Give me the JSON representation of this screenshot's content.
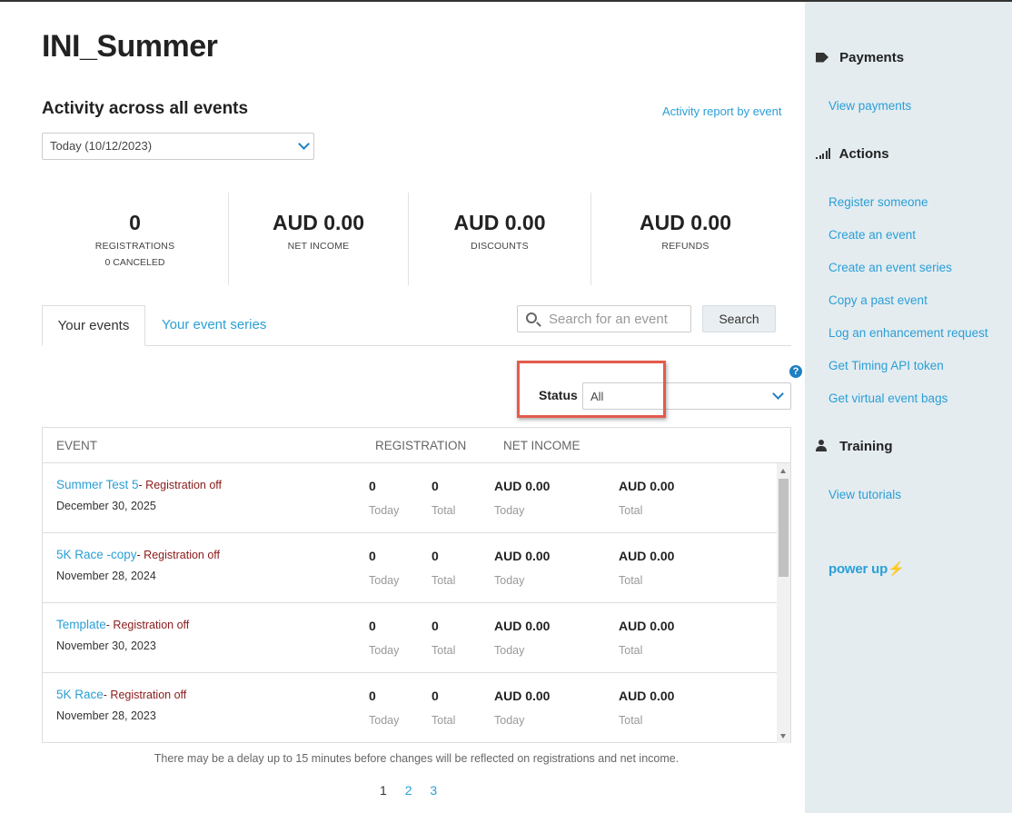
{
  "page": {
    "title": "INI_Summer"
  },
  "activity": {
    "title": "Activity across all events",
    "report_link": "Activity report by event",
    "date_range": "Today (10/12/2023)"
  },
  "stats": [
    {
      "value": "0",
      "label": "REGISTRATIONS",
      "sub": "0 CANCELED"
    },
    {
      "value": "AUD 0.00",
      "label": "NET INCOME"
    },
    {
      "value": "AUD 0.00",
      "label": "DISCOUNTS"
    },
    {
      "value": "AUD 0.00",
      "label": "REFUNDS"
    }
  ],
  "tabs": {
    "active": "Your events",
    "other": "Your event series"
  },
  "search": {
    "placeholder": "Search for an event",
    "button": "Search"
  },
  "status": {
    "label": "Status",
    "value": "All",
    "help": "?"
  },
  "table": {
    "headers": {
      "event": "EVENT",
      "registration": "REGISTRATION",
      "net_income": "NET INCOME"
    },
    "captions": {
      "today": "Today",
      "total": "Total"
    },
    "rows": [
      {
        "name": "Summer Test 5",
        "status": "- Registration off",
        "date": "December 30, 2025",
        "reg_today": "0",
        "reg_total": "0",
        "inc_today": "AUD 0.00",
        "inc_total": "AUD 0.00"
      },
      {
        "name": "5K Race -copy",
        "status": "- Registration off",
        "date": "November 28, 2024",
        "reg_today": "0",
        "reg_total": "0",
        "inc_today": "AUD 0.00",
        "inc_total": "AUD 0.00"
      },
      {
        "name": "Template",
        "status": "- Registration off",
        "date": "November 30, 2023",
        "reg_today": "0",
        "reg_total": "0",
        "inc_today": "AUD 0.00",
        "inc_total": "AUD 0.00"
      },
      {
        "name": "5K Race",
        "status": "- Registration off",
        "date": "November 28, 2023",
        "reg_today": "0",
        "reg_total": "0",
        "inc_today": "AUD 0.00",
        "inc_total": "AUD 0.00"
      }
    ]
  },
  "note": "There may be a delay up to 15 minutes before changes will be reflected on registrations and net income.",
  "pagination": {
    "current": "1",
    "pages": [
      "2",
      "3"
    ]
  },
  "sidebar": {
    "payments": {
      "title": "Payments",
      "icon": "tag-icon",
      "links": [
        "View payments"
      ]
    },
    "actions": {
      "title": "Actions",
      "icon": "signal-bars-icon",
      "links": [
        "Register someone",
        "Create an event",
        "Create an event series",
        "Copy a past event",
        "Log an enhancement request",
        "Get Timing API token",
        "Get virtual event bags"
      ]
    },
    "training": {
      "title": "Training",
      "icon": "user-icon",
      "links": [
        "View tutorials"
      ]
    },
    "brand": {
      "text": "power up",
      "bolt": "⚡"
    }
  },
  "colors": {
    "link": "#2a9fd6",
    "registration_off": "#8b1a1a",
    "highlight": "#e55b4d",
    "sidebar_bg": "#e4ecf0"
  }
}
